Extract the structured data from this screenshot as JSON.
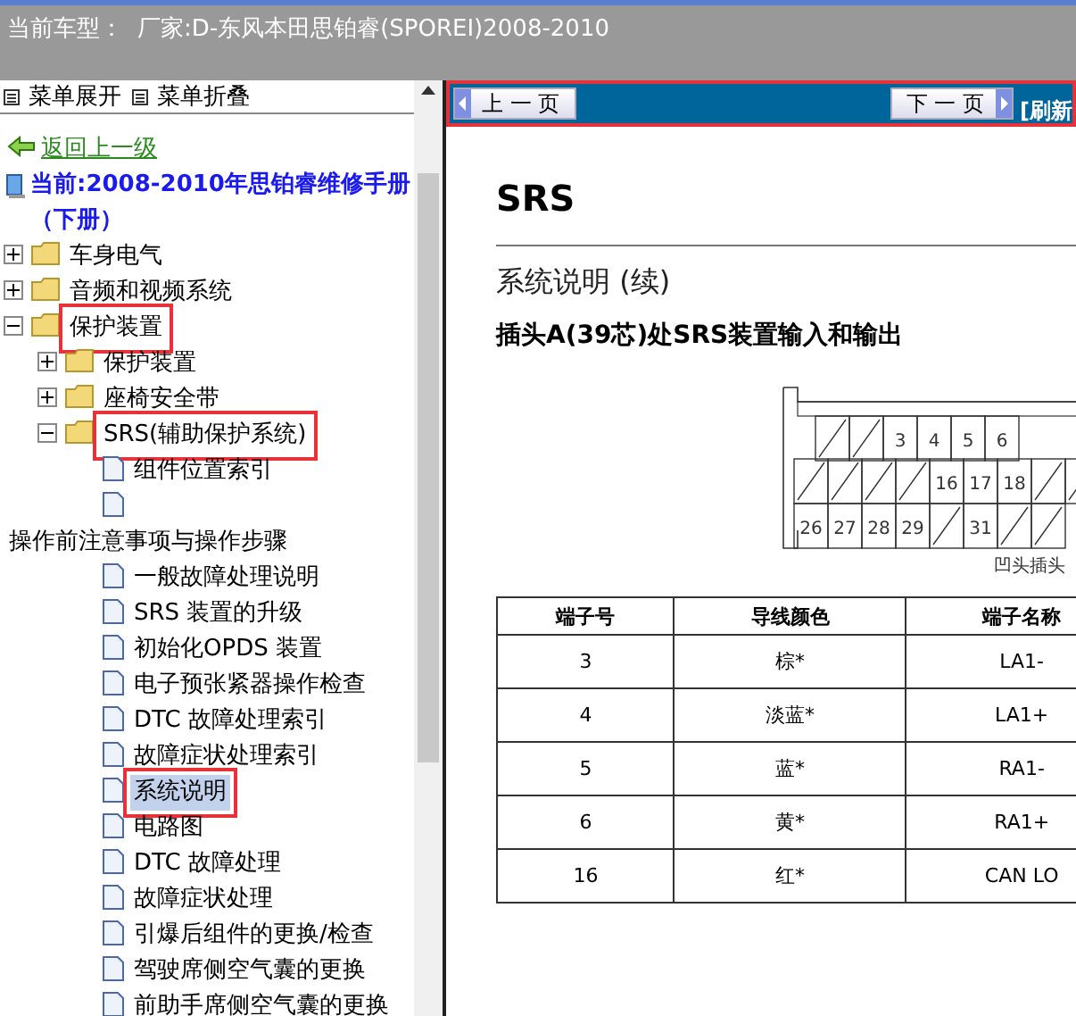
{
  "header": {
    "label": "当前车型：",
    "value": "厂家:D-东风本田思铂睿(SPOREI)2008-2010"
  },
  "menu": {
    "expand": "菜单展开",
    "collapse": "菜单折叠"
  },
  "back_link": "返回上一级",
  "current": "当前:2008-2010年思铂睿维修手册（下册）",
  "tree": [
    {
      "kind": "folder",
      "label": "车身电气",
      "expanded": false,
      "selected": false,
      "marked": false
    },
    {
      "kind": "folder",
      "label": "音频和视频系统",
      "expanded": false,
      "selected": false,
      "marked": false
    },
    {
      "kind": "folder",
      "label": "保护装置",
      "expanded": true,
      "selected": false,
      "marked": true,
      "children": [
        {
          "kind": "folder",
          "label": "保护装置",
          "expanded": false,
          "selected": false,
          "marked": false
        },
        {
          "kind": "folder",
          "label": "座椅安全带",
          "expanded": false,
          "selected": false,
          "marked": false
        },
        {
          "kind": "folder",
          "label": "SRS(辅助保护系统)",
          "expanded": true,
          "selected": false,
          "marked": true,
          "children": [
            {
              "label": "组件位置索引",
              "selected": false,
              "marked": false
            },
            {
              "label": "操作前注意事项与操作步骤",
              "selected": false,
              "marked": false
            },
            {
              "label": "一般故障处理说明",
              "selected": false,
              "marked": false
            },
            {
              "label": "SRS 装置的升级",
              "selected": false,
              "marked": false
            },
            {
              "label": "初始化OPDS 装置",
              "selected": false,
              "marked": false
            },
            {
              "label": "电子预张紧器操作检查",
              "selected": false,
              "marked": false
            },
            {
              "label": "DTC 故障处理索引",
              "selected": false,
              "marked": false
            },
            {
              "label": "故障症状处理索引",
              "selected": false,
              "marked": false
            },
            {
              "label": "系统说明",
              "selected": true,
              "marked": true
            },
            {
              "label": "电路图",
              "selected": false,
              "marked": false
            },
            {
              "label": "DTC 故障处理",
              "selected": false,
              "marked": false
            },
            {
              "label": "故障症状处理",
              "selected": false,
              "marked": false
            },
            {
              "label": "引爆后组件的更换/检查",
              "selected": false,
              "marked": false
            },
            {
              "label": "驾驶席侧空气囊的更换",
              "selected": false,
              "marked": false
            },
            {
              "label": "前助手席侧空气囊的更换",
              "selected": false,
              "marked": false
            }
          ]
        }
      ]
    }
  ],
  "nav": {
    "marked": true,
    "prev": "上 一 页",
    "next": "下 一 页",
    "refresh": "[刷新"
  },
  "document": {
    "title": "SRS",
    "section": "系统说明 (续)",
    "subtitle": "插头A(39芯)处SRS装置输入和输出",
    "connector_pins": [
      "3",
      "4",
      "5",
      "6",
      "16",
      "17",
      "18",
      "26",
      "27",
      "28",
      "29",
      "31"
    ],
    "connector_caption": "凹头插头",
    "table": {
      "columns": [
        "端子号",
        "导线颜色",
        "端子名称"
      ],
      "rows": [
        [
          "3",
          "棕*",
          "LA1-"
        ],
        [
          "4",
          "淡蓝*",
          "LA1+"
        ],
        [
          "5",
          "蓝*",
          "RA1-"
        ],
        [
          "6",
          "黄*",
          "RA1+"
        ],
        [
          "16",
          "红*",
          "CAN LO"
        ]
      ]
    }
  }
}
